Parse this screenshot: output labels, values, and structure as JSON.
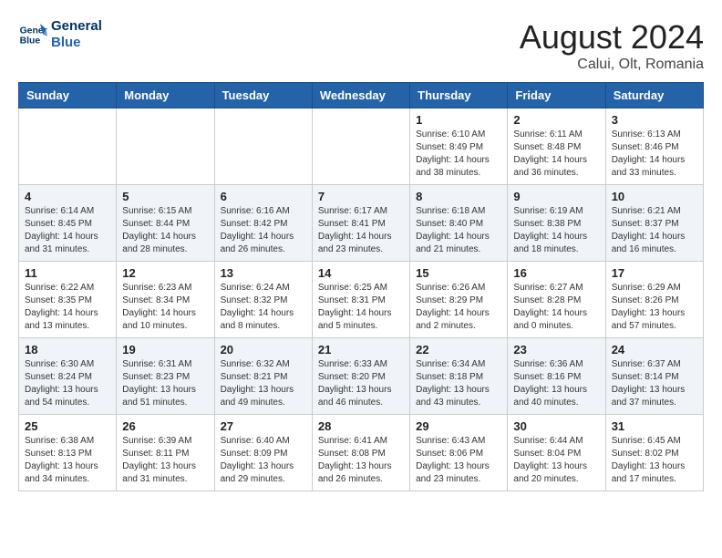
{
  "header": {
    "logo_line1": "General",
    "logo_line2": "Blue",
    "month": "August 2024",
    "location": "Calui, Olt, Romania"
  },
  "weekdays": [
    "Sunday",
    "Monday",
    "Tuesday",
    "Wednesday",
    "Thursday",
    "Friday",
    "Saturday"
  ],
  "weeks": [
    [
      {
        "day": "",
        "info": ""
      },
      {
        "day": "",
        "info": ""
      },
      {
        "day": "",
        "info": ""
      },
      {
        "day": "",
        "info": ""
      },
      {
        "day": "1",
        "info": "Sunrise: 6:10 AM\nSunset: 8:49 PM\nDaylight: 14 hours\nand 38 minutes."
      },
      {
        "day": "2",
        "info": "Sunrise: 6:11 AM\nSunset: 8:48 PM\nDaylight: 14 hours\nand 36 minutes."
      },
      {
        "day": "3",
        "info": "Sunrise: 6:13 AM\nSunset: 8:46 PM\nDaylight: 14 hours\nand 33 minutes."
      }
    ],
    [
      {
        "day": "4",
        "info": "Sunrise: 6:14 AM\nSunset: 8:45 PM\nDaylight: 14 hours\nand 31 minutes."
      },
      {
        "day": "5",
        "info": "Sunrise: 6:15 AM\nSunset: 8:44 PM\nDaylight: 14 hours\nand 28 minutes."
      },
      {
        "day": "6",
        "info": "Sunrise: 6:16 AM\nSunset: 8:42 PM\nDaylight: 14 hours\nand 26 minutes."
      },
      {
        "day": "7",
        "info": "Sunrise: 6:17 AM\nSunset: 8:41 PM\nDaylight: 14 hours\nand 23 minutes."
      },
      {
        "day": "8",
        "info": "Sunrise: 6:18 AM\nSunset: 8:40 PM\nDaylight: 14 hours\nand 21 minutes."
      },
      {
        "day": "9",
        "info": "Sunrise: 6:19 AM\nSunset: 8:38 PM\nDaylight: 14 hours\nand 18 minutes."
      },
      {
        "day": "10",
        "info": "Sunrise: 6:21 AM\nSunset: 8:37 PM\nDaylight: 14 hours\nand 16 minutes."
      }
    ],
    [
      {
        "day": "11",
        "info": "Sunrise: 6:22 AM\nSunset: 8:35 PM\nDaylight: 14 hours\nand 13 minutes."
      },
      {
        "day": "12",
        "info": "Sunrise: 6:23 AM\nSunset: 8:34 PM\nDaylight: 14 hours\nand 10 minutes."
      },
      {
        "day": "13",
        "info": "Sunrise: 6:24 AM\nSunset: 8:32 PM\nDaylight: 14 hours\nand 8 minutes."
      },
      {
        "day": "14",
        "info": "Sunrise: 6:25 AM\nSunset: 8:31 PM\nDaylight: 14 hours\nand 5 minutes."
      },
      {
        "day": "15",
        "info": "Sunrise: 6:26 AM\nSunset: 8:29 PM\nDaylight: 14 hours\nand 2 minutes."
      },
      {
        "day": "16",
        "info": "Sunrise: 6:27 AM\nSunset: 8:28 PM\nDaylight: 14 hours\nand 0 minutes."
      },
      {
        "day": "17",
        "info": "Sunrise: 6:29 AM\nSunset: 8:26 PM\nDaylight: 13 hours\nand 57 minutes."
      }
    ],
    [
      {
        "day": "18",
        "info": "Sunrise: 6:30 AM\nSunset: 8:24 PM\nDaylight: 13 hours\nand 54 minutes."
      },
      {
        "day": "19",
        "info": "Sunrise: 6:31 AM\nSunset: 8:23 PM\nDaylight: 13 hours\nand 51 minutes."
      },
      {
        "day": "20",
        "info": "Sunrise: 6:32 AM\nSunset: 8:21 PM\nDaylight: 13 hours\nand 49 minutes."
      },
      {
        "day": "21",
        "info": "Sunrise: 6:33 AM\nSunset: 8:20 PM\nDaylight: 13 hours\nand 46 minutes."
      },
      {
        "day": "22",
        "info": "Sunrise: 6:34 AM\nSunset: 8:18 PM\nDaylight: 13 hours\nand 43 minutes."
      },
      {
        "day": "23",
        "info": "Sunrise: 6:36 AM\nSunset: 8:16 PM\nDaylight: 13 hours\nand 40 minutes."
      },
      {
        "day": "24",
        "info": "Sunrise: 6:37 AM\nSunset: 8:14 PM\nDaylight: 13 hours\nand 37 minutes."
      }
    ],
    [
      {
        "day": "25",
        "info": "Sunrise: 6:38 AM\nSunset: 8:13 PM\nDaylight: 13 hours\nand 34 minutes."
      },
      {
        "day": "26",
        "info": "Sunrise: 6:39 AM\nSunset: 8:11 PM\nDaylight: 13 hours\nand 31 minutes."
      },
      {
        "day": "27",
        "info": "Sunrise: 6:40 AM\nSunset: 8:09 PM\nDaylight: 13 hours\nand 29 minutes."
      },
      {
        "day": "28",
        "info": "Sunrise: 6:41 AM\nSunset: 8:08 PM\nDaylight: 13 hours\nand 26 minutes."
      },
      {
        "day": "29",
        "info": "Sunrise: 6:43 AM\nSunset: 8:06 PM\nDaylight: 13 hours\nand 23 minutes."
      },
      {
        "day": "30",
        "info": "Sunrise: 6:44 AM\nSunset: 8:04 PM\nDaylight: 13 hours\nand 20 minutes."
      },
      {
        "day": "31",
        "info": "Sunrise: 6:45 AM\nSunset: 8:02 PM\nDaylight: 13 hours\nand 17 minutes."
      }
    ]
  ]
}
